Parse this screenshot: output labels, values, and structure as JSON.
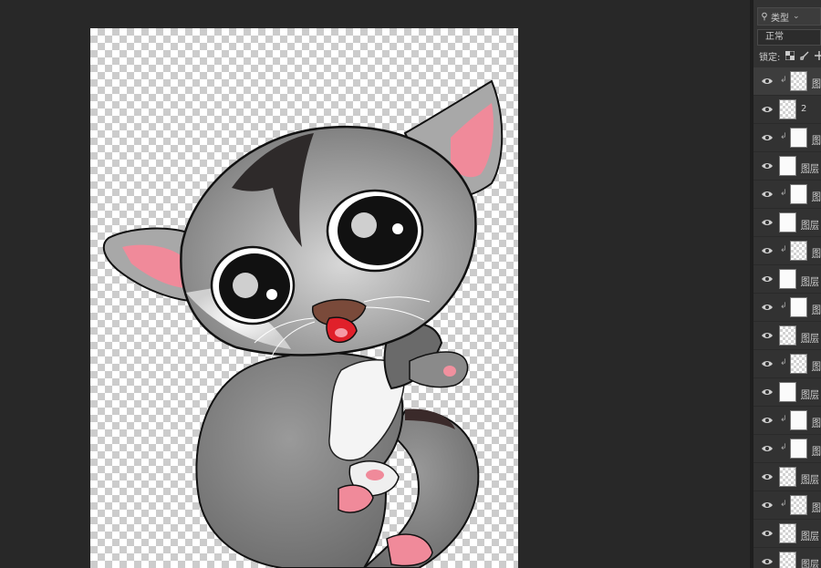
{
  "layers_panel": {
    "filter_label": "类型",
    "blend_mode": "正常",
    "lock_label": "锁定:",
    "layers": [
      {
        "name": "图",
        "clipped": true,
        "thumb": "checker",
        "selected": true
      },
      {
        "name": "2",
        "clipped": false,
        "thumb": "checker",
        "selected": false
      },
      {
        "name": "图",
        "clipped": true,
        "thumb": "plain",
        "selected": false
      },
      {
        "name": "图层",
        "clipped": false,
        "thumb": "plain",
        "selected": false
      },
      {
        "name": "图",
        "clipped": true,
        "thumb": "plain",
        "selected": false
      },
      {
        "name": "图层",
        "clipped": false,
        "thumb": "plain",
        "selected": false
      },
      {
        "name": "图",
        "clipped": true,
        "thumb": "checker",
        "selected": false
      },
      {
        "name": "图层",
        "clipped": false,
        "thumb": "plain",
        "selected": false
      },
      {
        "name": "图",
        "clipped": true,
        "thumb": "plain",
        "selected": false
      },
      {
        "name": "图层",
        "clipped": false,
        "thumb": "checker",
        "selected": false
      },
      {
        "name": "图",
        "clipped": true,
        "thumb": "checker",
        "selected": false
      },
      {
        "name": "图层",
        "clipped": false,
        "thumb": "plain",
        "selected": false
      },
      {
        "name": "图",
        "clipped": true,
        "thumb": "plain",
        "selected": false
      },
      {
        "name": "图",
        "clipped": true,
        "thumb": "plain",
        "selected": false
      },
      {
        "name": "图层",
        "clipped": false,
        "thumb": "checker",
        "selected": false
      },
      {
        "name": "图",
        "clipped": true,
        "thumb": "checker",
        "selected": false
      },
      {
        "name": "图层",
        "clipped": false,
        "thumb": "checker",
        "selected": false
      },
      {
        "name": "图层",
        "clipped": false,
        "thumb": "checker",
        "selected": false
      }
    ]
  },
  "colors": {
    "workspace_bg": "#282828",
    "panel_bg": "#323232",
    "fur_gray": "#9a9a9a",
    "ear_pink": "#f08a9a"
  }
}
